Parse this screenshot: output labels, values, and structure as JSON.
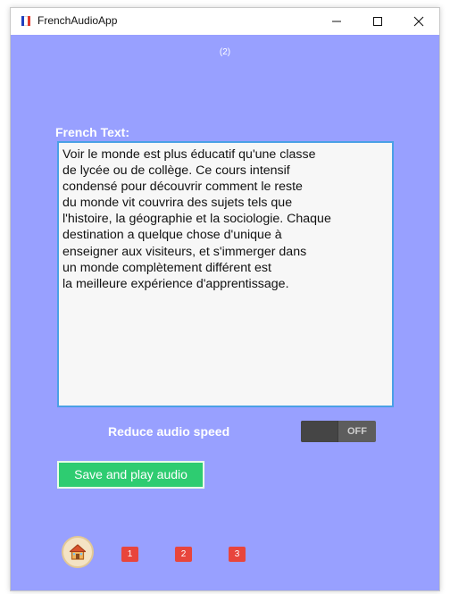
{
  "window": {
    "title": "FrenchAudioApp",
    "icon_colors": [
      "#1f3fbf",
      "#ffffff",
      "#e0392d"
    ]
  },
  "page": {
    "indicator": "(2)"
  },
  "editor": {
    "label": "French Text:",
    "text": "Voir le monde est plus éducatif qu'une classe\nde lycée ou de collège. Ce cours intensif\ncondensé pour découvrir comment le reste\ndu monde vit couvrira des sujets tels que\nl'histoire, la géographie et la sociologie. Chaque\ndestination a quelque chose d'unique à\nenseigner aux visiteurs, et s'immerger dans\nun monde complètement différent est\nla meilleure expérience d'apprentissage."
  },
  "speed": {
    "label": "Reduce audio speed",
    "toggle_state": "OFF"
  },
  "actions": {
    "save_play_label": "Save and play audio"
  },
  "nav": {
    "home_icon": "home-icon",
    "buttons": [
      "1",
      "2",
      "3"
    ]
  },
  "colors": {
    "background": "#98a0ff",
    "save_button": "#2ecc71",
    "nav_button": "#e8453c",
    "textarea_border": "#4aa0e6"
  }
}
